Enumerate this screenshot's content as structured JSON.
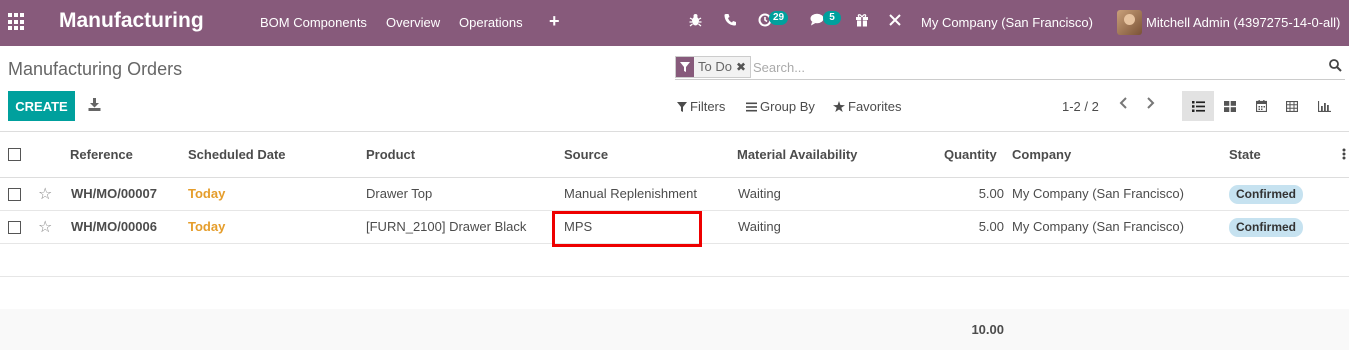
{
  "navbar": {
    "app_name": "Manufacturing",
    "menu": [
      "BOM Components",
      "Overview",
      "Operations"
    ],
    "activity_count": "29",
    "message_count": "5",
    "company": "My Company (San Francisco)",
    "user": "Mitchell Admin (4397275-14-0-all)"
  },
  "control": {
    "breadcrumb": "Manufacturing Orders",
    "facet": "To Do",
    "search_placeholder": "Search...",
    "create_label": "CREATE",
    "filters_label": "Filters",
    "groupby_label": "Group By",
    "favorites_label": "Favorites",
    "pager": "1-2 / 2"
  },
  "table": {
    "columns": [
      "Reference",
      "Scheduled Date",
      "Product",
      "Source",
      "Material Availability",
      "Quantity",
      "Company",
      "State"
    ],
    "rows": [
      {
        "reference": "WH/MO/00007",
        "date": "Today",
        "product": "Drawer Top",
        "source": "Manual Replenishment",
        "availability": "Waiting",
        "quantity": "5.00",
        "company": "My Company (San Francisco)",
        "state": "Confirmed"
      },
      {
        "reference": "WH/MO/00006",
        "date": "Today",
        "product": "[FURN_2100] Drawer Black",
        "source": "MPS",
        "availability": "Waiting",
        "quantity": "5.00",
        "company": "My Company (San Francisco)",
        "state": "Confirmed"
      }
    ],
    "total_quantity": "10.00"
  },
  "colors": {
    "brand": "#875a7b",
    "primary": "#00a09d",
    "today": "#e59d2b",
    "highlight": "#ee0000"
  }
}
